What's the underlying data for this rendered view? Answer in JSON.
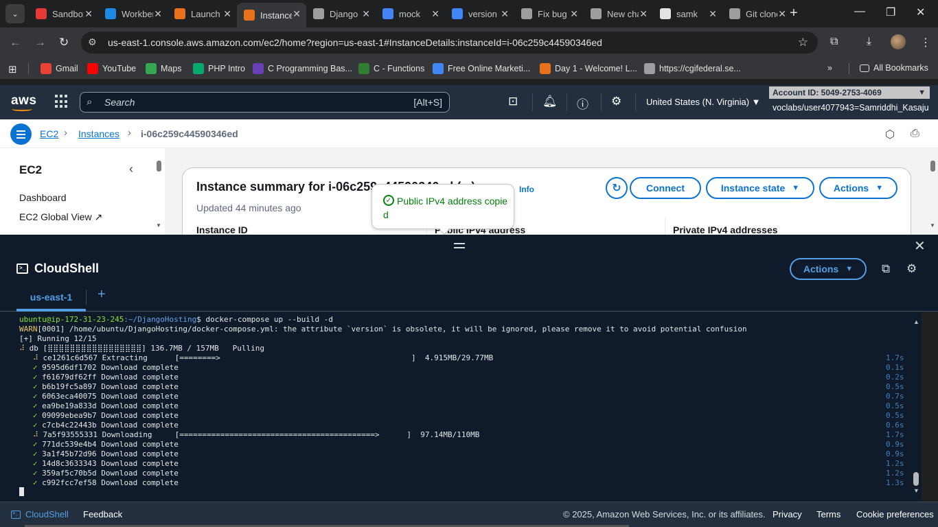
{
  "browser": {
    "tabs": [
      {
        "title": "Sandbox",
        "icon": "sandbox-icon",
        "color": "#e53935"
      },
      {
        "title": "Workbench",
        "icon": "vocareum-icon",
        "color": "#1e88e5"
      },
      {
        "title": "Launch",
        "icon": "aws-icon",
        "color": "#e8711a"
      },
      {
        "title": "Instance",
        "icon": "aws-icon",
        "color": "#e8711a"
      },
      {
        "title": "Django",
        "icon": "openai-icon",
        "color": "#9e9e9e"
      },
      {
        "title": "mock",
        "icon": "google-icon",
        "color": "#4285f4"
      },
      {
        "title": "version",
        "icon": "google-icon",
        "color": "#4285f4"
      },
      {
        "title": "Fix bug",
        "icon": "openai-icon",
        "color": "#9e9e9e"
      },
      {
        "title": "New chat",
        "icon": "openai-icon",
        "color": "#9e9e9e"
      },
      {
        "title": "samk",
        "icon": "github-icon",
        "color": "#e3e3e3"
      },
      {
        "title": "Git clone",
        "icon": "openai-icon",
        "color": "#9e9e9e"
      }
    ],
    "active_tab": 3,
    "url_host": "us-east-1.console.aws.amazon.com",
    "url_path": "/ec2/home?region=us-east-1#InstanceDetails:instanceId=i-06c259c44590346ed",
    "bookmarks": [
      {
        "label": "Gmail",
        "icon": "gmail-icon",
        "color": "#ea4335"
      },
      {
        "label": "YouTube",
        "icon": "youtube-icon",
        "color": "#ff0000"
      },
      {
        "label": "Maps",
        "icon": "maps-icon",
        "color": "#34a853"
      },
      {
        "label": "PHP Intro",
        "icon": "w3schools-icon",
        "color": "#04aa6d"
      },
      {
        "label": "C Programming Bas...",
        "icon": "tutorial-icon",
        "color": "#6a3fb5"
      },
      {
        "label": "C - Functions",
        "icon": "tutorial-icon",
        "color": "#2e7d32"
      },
      {
        "label": "Free Online Marketi...",
        "icon": "google-icon",
        "color": "#4285f4"
      },
      {
        "label": "Day 1 - Welcome! L...",
        "icon": "course-icon",
        "color": "#e8711a"
      },
      {
        "label": "https://cgifederal.se...",
        "icon": "globe-icon",
        "color": "#9e9e9e"
      }
    ],
    "all_bookmarks": "All Bookmarks"
  },
  "aws": {
    "logo": "aws",
    "search_placeholder": "Search",
    "search_shortcut": "[Alt+S]",
    "region": "United States (N. Virginia)",
    "account_id": "Account ID: 5049-2753-4069",
    "user": "voclabs/user4077943=Samriddhi_Kasaju",
    "breadcrumb": [
      "EC2",
      "Instances",
      "i-06c259c44590346ed"
    ],
    "nav_title": "EC2",
    "nav_items": [
      "Dashboard",
      "EC2 Global View"
    ],
    "summary_title": "Instance summary for i-06c259c44590346ed (...)",
    "info": "Info",
    "updated": "Updated 44 minutes ago",
    "columns": [
      "Instance ID",
      "Public IPv4 address",
      "Private IPv4 addresses"
    ],
    "connect": "Connect",
    "instance_state": "Instance state",
    "actions": "Actions",
    "popover": "Public IPv4 address copied"
  },
  "cloudshell": {
    "title": "CloudShell",
    "actions": "Actions",
    "tab": "us-east-1",
    "terminal": {
      "prompt_user": "ubuntu@ip-172-31-23-245",
      "prompt_path": ":~/DjangoHosting",
      "command": "$ docker-compose up --build -d",
      "warn_prefix": "WARN",
      "warn_text": "[0001] /home/ubuntu/DjangoHosting/docker-compose.yml: the attribute `version` is obsolete, it will be ignored, please remove it to avoid potential confusion",
      "running": "[+] Running 12/15",
      "db_line": " db [⣿⣿⣿⣿⣿⣿⣿⣿⣿⣿⣿⣿⣿⣿⣿⣿⣿] 136.7MB / 157MB   Pulling",
      "layers": [
        {
          "status": "spin",
          "id": "ce1261c6d567",
          "text": "Extracting      [========>                                          ]  4.915MB/29.77MB",
          "time": "1.7s"
        },
        {
          "status": "done",
          "id": "9595d6df1702",
          "text": "Download complete",
          "time": "0.1s"
        },
        {
          "status": "done",
          "id": "f61679df62ff",
          "text": "Download complete",
          "time": "0.2s"
        },
        {
          "status": "done",
          "id": "b6b19fc5a897",
          "text": "Download complete",
          "time": "0.5s"
        },
        {
          "status": "done",
          "id": "6063eca40075",
          "text": "Download complete",
          "time": "0.7s"
        },
        {
          "status": "done",
          "id": "ea9be19a833d",
          "text": "Download complete",
          "time": "0.5s"
        },
        {
          "status": "done",
          "id": "09099ebea9b7",
          "text": "Download complete",
          "time": "0.5s"
        },
        {
          "status": "done",
          "id": "c7cb4c22443b",
          "text": "Download complete",
          "time": "0.6s"
        },
        {
          "status": "spin",
          "id": "7a5f93555331",
          "text": "Downloading     [===========================================>      ]  97.14MB/110MB",
          "time": "1.7s"
        },
        {
          "status": "done",
          "id": "771dc539e4b4",
          "text": "Download complete",
          "time": "0.9s"
        },
        {
          "status": "done",
          "id": "3a1f45b72d96",
          "text": "Download complete",
          "time": "0.9s"
        },
        {
          "status": "done",
          "id": "14d8c3633343",
          "text": "Download complete",
          "time": "1.2s"
        },
        {
          "status": "done",
          "id": "359af5c70b5d",
          "text": "Download complete",
          "time": "1.2s"
        },
        {
          "status": "done",
          "id": "c992fcc7ef58",
          "text": "Download complete",
          "time": "1.3s"
        }
      ]
    }
  },
  "footer": {
    "cloudshell": "CloudShell",
    "feedback": "Feedback",
    "copyright": "© 2025, Amazon Web Services, Inc. or its affiliates.",
    "privacy": "Privacy",
    "terms": "Terms",
    "cookies": "Cookie preferences"
  }
}
